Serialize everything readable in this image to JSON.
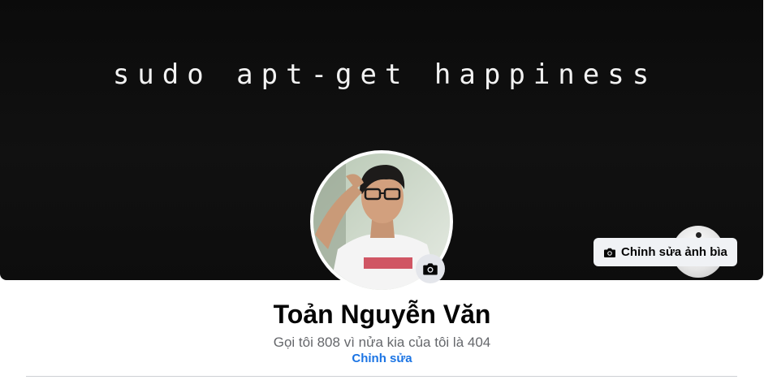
{
  "cover": {
    "text": "sudo apt-get happiness",
    "edit_button_label": "Chỉnh sửa ảnh bìa",
    "edit_button_icon": "camera-icon"
  },
  "avatar": {
    "camera_button_icon": "camera-icon"
  },
  "profile": {
    "name": "Toản Nguyễn Văn",
    "bio": "Gọi tôi 808 vì nửa kia của tôi là 404",
    "edit_bio_label": "Chỉnh sửa"
  },
  "colors": {
    "cover_background": "#0d0d0d",
    "button_background": "#e4e6eb",
    "link_blue": "#1b74e4",
    "secondary_text": "#65676b"
  }
}
